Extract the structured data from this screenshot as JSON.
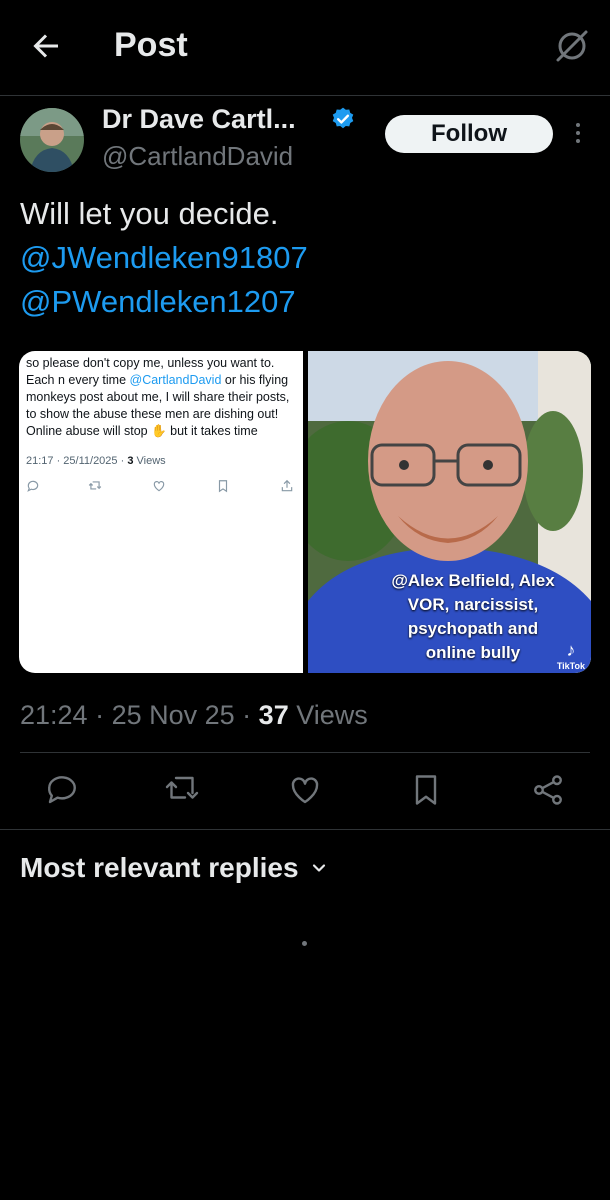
{
  "header": {
    "title": "Post",
    "back_icon": "arrow-left-icon",
    "grok_icon": "grok-icon"
  },
  "author": {
    "display_name": "Dr Dave Cartl...",
    "handle": "@CartlandDavid",
    "verified": true,
    "verified_color": "#1d9bf0",
    "follow_label": "Follow"
  },
  "tweet": {
    "text": "Will let you decide.",
    "mentions": [
      "@JWendleken91807",
      "@PWendleken1207"
    ]
  },
  "media": {
    "left_screenshot": {
      "line1": "so please don't copy me, unless you want to.",
      "line2_before": "Each n every time ",
      "line2_mention": "@CartlandDavid",
      "line2_after": " or his flying monkeys post about me, I will share their posts, to show the abuse these men are dishing out!",
      "line3_before": "Online abuse will stop ",
      "line3_emoji": "✋",
      "line3_after": " but it takes time",
      "meta_time": "21:17 · 25/11/2025 · ",
      "meta_views": "3",
      "meta_views_label": " Views"
    },
    "right_video": {
      "caption": "@Alex Belfield, Alex VOR, narcissist, psychopath and online bully",
      "watermark": "TikTok"
    }
  },
  "meta": {
    "time": "21:24",
    "date": "25 Nov 25",
    "views_count": "37",
    "views_label": "Views",
    "separator": " · "
  },
  "actions": [
    "reply-icon",
    "retweet-icon",
    "like-icon",
    "bookmark-icon",
    "share-icon"
  ],
  "replies": {
    "sort_label": "Most relevant replies"
  },
  "colors": {
    "background": "#000000",
    "accent": "#1d9bf0",
    "muted": "#71767b",
    "text": "#e7e9ea"
  }
}
